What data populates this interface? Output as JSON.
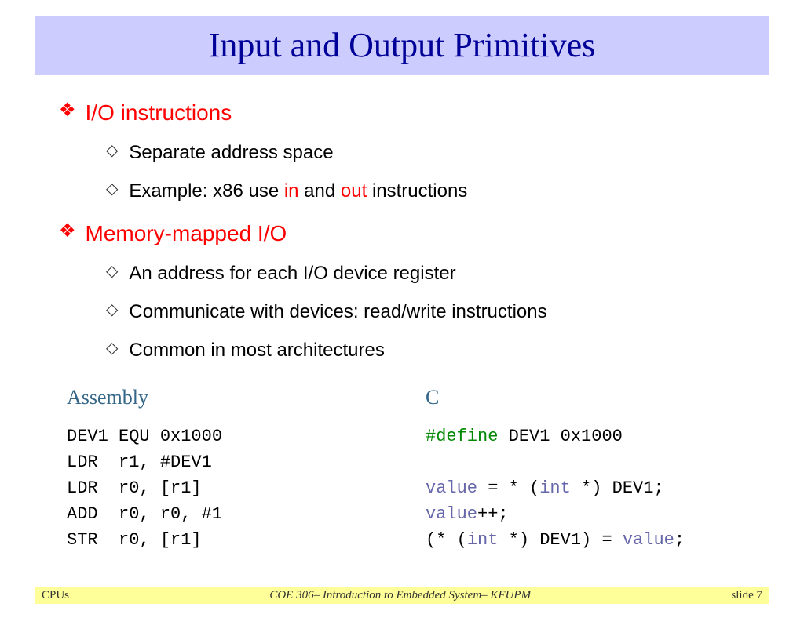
{
  "title": "Input and Output Primitives",
  "sections": [
    {
      "heading": "I/O instructions",
      "items": [
        {
          "pre": "Separate address space",
          "hl1": "",
          "mid": "",
          "hl2": "",
          "post": ""
        },
        {
          "pre": "Example: x86 use ",
          "hl1": "in",
          "mid": " and ",
          "hl2": "out",
          "post": " instructions"
        }
      ]
    },
    {
      "heading": "Memory-mapped I/O",
      "items": [
        {
          "pre": "An address for each I/O device register",
          "hl1": "",
          "mid": "",
          "hl2": "",
          "post": ""
        },
        {
          "pre": "Communicate with devices: read/write instructions",
          "hl1": "",
          "mid": "",
          "hl2": "",
          "post": ""
        },
        {
          "pre": "Common in most architectures",
          "hl1": "",
          "mid": "",
          "hl2": "",
          "post": ""
        }
      ]
    }
  ],
  "code": {
    "left_heading": "Assembly",
    "right_heading": "C",
    "asm": "DEV1 EQU 0x1000\nLDR  r1, #DEV1\nLDR  r0, [r1]\nADD  r0, r0, #1\nSTR  r0, [r1]",
    "c": {
      "l1_kw": "#define",
      "l1_rest": " DEV1 0x1000",
      "l3_var1": "value",
      "l3_a": " = * (",
      "l3_type1": "int",
      "l3_b": " *) DEV1;",
      "l4_var": "value",
      "l4_rest": "++;",
      "l5_a": "(* (",
      "l5_type": "int",
      "l5_b": " *) DEV1) = ",
      "l5_var": "value",
      "l5_c": ";"
    }
  },
  "footer": {
    "left": "CPUs",
    "mid": "COE 306– Introduction to Embedded System– KFUPM",
    "right": "slide 7"
  }
}
